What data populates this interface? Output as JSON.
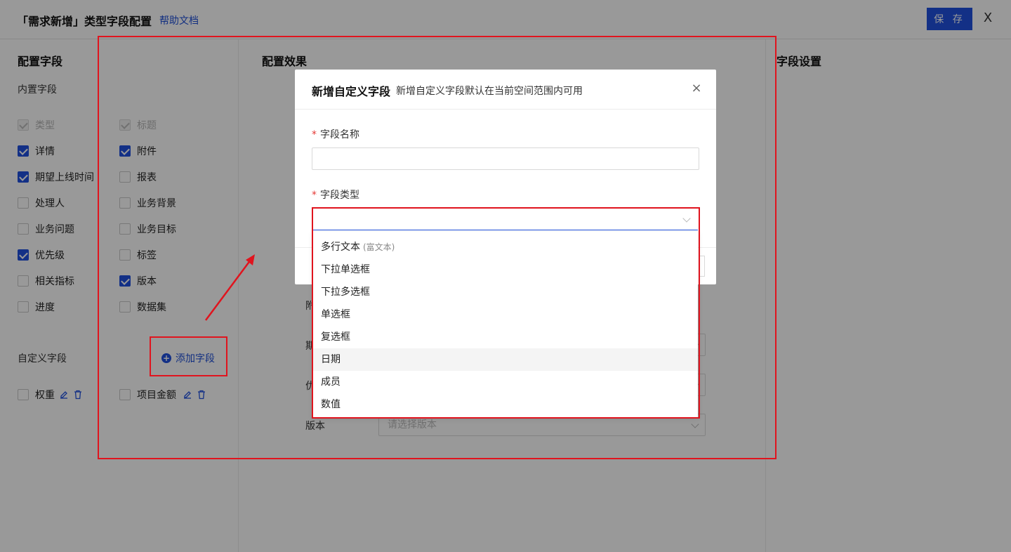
{
  "header": {
    "title": "「需求新增」类型字段配置",
    "help_link": "帮助文档",
    "save_label": "保 存",
    "close_glyph": "X"
  },
  "config_fields": {
    "title": "配置字段",
    "builtin_label": "内置字段",
    "builtin_left": [
      {
        "label": "类型",
        "state": "disabled"
      },
      {
        "label": "详情",
        "state": "checked"
      },
      {
        "label": "期望上线时间",
        "state": "checked"
      },
      {
        "label": "处理人",
        "state": "unchecked"
      },
      {
        "label": "业务问题",
        "state": "unchecked"
      },
      {
        "label": "优先级",
        "state": "checked"
      },
      {
        "label": "相关指标",
        "state": "unchecked"
      },
      {
        "label": "进度",
        "state": "unchecked"
      }
    ],
    "builtin_right": [
      {
        "label": "标题",
        "state": "disabled"
      },
      {
        "label": "附件",
        "state": "checked"
      },
      {
        "label": "报表",
        "state": "unchecked"
      },
      {
        "label": "业务背景",
        "state": "unchecked"
      },
      {
        "label": "业务目标",
        "state": "unchecked"
      },
      {
        "label": "标签",
        "state": "unchecked"
      },
      {
        "label": "版本",
        "state": "checked"
      },
      {
        "label": "数据集",
        "state": "unchecked"
      }
    ],
    "custom_label": "自定义字段",
    "add_field_label": "添加字段",
    "custom_fields": [
      {
        "label": "权重",
        "state": "unchecked"
      },
      {
        "label": "项目金额",
        "state": "unchecked"
      }
    ]
  },
  "config_effect": {
    "title": "配置效果",
    "rows": [
      {
        "label": "附"
      },
      {
        "label": "期"
      },
      {
        "label": "优"
      },
      {
        "label": "版本",
        "placeholder": "请选择版本"
      }
    ]
  },
  "field_settings": {
    "title": "字段设置"
  },
  "modal": {
    "title": "新增自定义字段",
    "subtitle": "新增自定义字段默认在当前空间范围内可用",
    "close_glyph": "×",
    "required_mark": "*",
    "name_label": "字段名称",
    "name_value": "",
    "type_label": "字段类型",
    "type_value": "",
    "options": [
      {
        "label": "多行文本",
        "hint": "(富文本)"
      },
      {
        "label": "下拉单选框"
      },
      {
        "label": "下拉多选框"
      },
      {
        "label": "单选框"
      },
      {
        "label": "复选框"
      },
      {
        "label": "日期",
        "hovered": true
      },
      {
        "label": "成员"
      },
      {
        "label": "数值"
      }
    ]
  },
  "colors": {
    "accent": "#2051e0",
    "annotation": "#e0141e"
  }
}
